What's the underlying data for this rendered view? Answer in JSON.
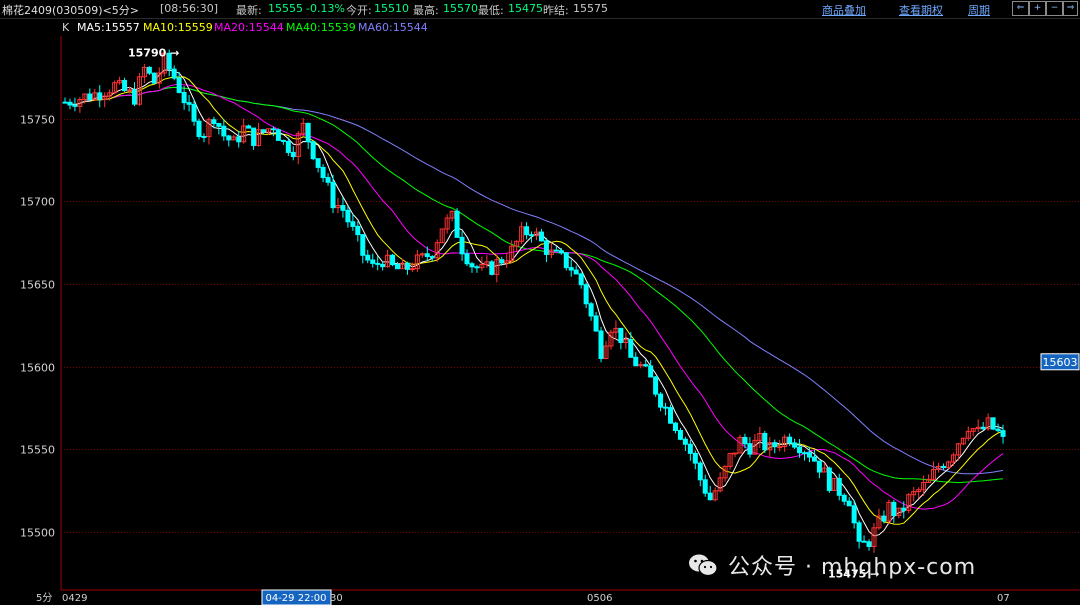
{
  "header": {
    "symbol": "棉花2409(030509)<5分>",
    "time": "[08:56:30]",
    "last_label": "最新:",
    "last": "15555",
    "change": "-0.13%",
    "open_label": "今开:",
    "open": "15510",
    "high_label": "最高:",
    "high": "15570",
    "low_label": "最低:",
    "low": "15475",
    "prev_close_label": "昨结:",
    "prev_close": "15575",
    "link_overlay": "商品叠加",
    "link_options": "查看期权",
    "link_period": "周期"
  },
  "legend": {
    "k": "K",
    "ma5": "MA5:15557",
    "ma10": "MA10:15559",
    "ma20": "MA20:15544",
    "ma40": "MA40:15539",
    "ma60": "MA60:15544"
  },
  "bottom": {
    "period": "5分",
    "cursor_label": "04-29 22:00"
  },
  "watermark": "公众号 · mhqhpx-com",
  "colors": {
    "up": "#ff3232",
    "down": "#00ffff",
    "ma5": "#ffffff",
    "ma10": "#ffff00",
    "ma20": "#ff00ff",
    "ma40": "#00ff00",
    "ma60": "#8080ff",
    "grid": "#7a0000",
    "axis": "#a00000",
    "price_tag": "#1565c0"
  },
  "chart_data": {
    "type": "candlestick",
    "ylim": [
      15465,
      15800
    ],
    "yticks": [
      15500,
      15550,
      15600,
      15650,
      15700,
      15750
    ],
    "xticks": [
      "0429",
      "30",
      "0506",
      "07"
    ],
    "current_price": 15603,
    "annotations": [
      {
        "label": "15790",
        "price": 15790
      },
      {
        "label": "15475",
        "price": 15475
      }
    ],
    "path": [
      [
        0,
        15760
      ],
      [
        6,
        15765
      ],
      [
        10,
        15770
      ],
      [
        14,
        15763
      ],
      [
        16,
        15780
      ],
      [
        18,
        15772
      ],
      [
        20,
        15785
      ],
      [
        22,
        15775
      ],
      [
        24,
        15762
      ],
      [
        26,
        15746
      ],
      [
        28,
        15742
      ],
      [
        30,
        15752
      ],
      [
        32,
        15740
      ],
      [
        34,
        15735
      ],
      [
        36,
        15744
      ],
      [
        38,
        15738
      ],
      [
        40,
        15742
      ],
      [
        42,
        15746
      ],
      [
        44,
        15735
      ],
      [
        46,
        15732
      ],
      [
        48,
        15745
      ],
      [
        50,
        15730
      ],
      [
        52,
        15715
      ],
      [
        54,
        15700
      ],
      [
        56,
        15695
      ],
      [
        58,
        15682
      ],
      [
        60,
        15668
      ],
      [
        62,
        15660
      ],
      [
        64,
        15665
      ],
      [
        66,
        15660
      ],
      [
        68,
        15658
      ],
      [
        70,
        15662
      ],
      [
        72,
        15665
      ],
      [
        74,
        15670
      ],
      [
        76,
        15685
      ],
      [
        78,
        15690
      ],
      [
        80,
        15672
      ],
      [
        82,
        15662
      ],
      [
        84,
        15658
      ],
      [
        86,
        15660
      ],
      [
        88,
        15665
      ],
      [
        90,
        15670
      ],
      [
        92,
        15680
      ],
      [
        94,
        15683
      ],
      [
        96,
        15675
      ],
      [
        98,
        15668
      ],
      [
        100,
        15665
      ],
      [
        102,
        15660
      ],
      [
        104,
        15650
      ],
      [
        106,
        15630
      ],
      [
        108,
        15610
      ],
      [
        110,
        15625
      ],
      [
        112,
        15618
      ],
      [
        114,
        15605
      ],
      [
        116,
        15600
      ],
      [
        118,
        15592
      ],
      [
        120,
        15580
      ],
      [
        122,
        15570
      ],
      [
        124,
        15560
      ],
      [
        126,
        15548
      ],
      [
        128,
        15532
      ],
      [
        130,
        15520
      ],
      [
        132,
        15530
      ],
      [
        134,
        15545
      ],
      [
        136,
        15555
      ],
      [
        138,
        15552
      ],
      [
        140,
        15555
      ],
      [
        142,
        15550
      ],
      [
        144,
        15555
      ],
      [
        146,
        15558
      ],
      [
        148,
        15553
      ],
      [
        150,
        15548
      ],
      [
        152,
        15540
      ],
      [
        154,
        15530
      ],
      [
        156,
        15525
      ],
      [
        158,
        15520
      ],
      [
        160,
        15490
      ],
      [
        162,
        15495
      ],
      [
        164,
        15505
      ],
      [
        166,
        15515
      ],
      [
        168,
        15510
      ],
      [
        170,
        15520
      ],
      [
        172,
        15525
      ],
      [
        174,
        15530
      ],
      [
        176,
        15540
      ],
      [
        178,
        15545
      ],
      [
        180,
        15555
      ],
      [
        182,
        15565
      ],
      [
        184,
        15560
      ],
      [
        186,
        15565
      ],
      [
        188,
        15560
      ],
      [
        189,
        15555
      ]
    ]
  }
}
